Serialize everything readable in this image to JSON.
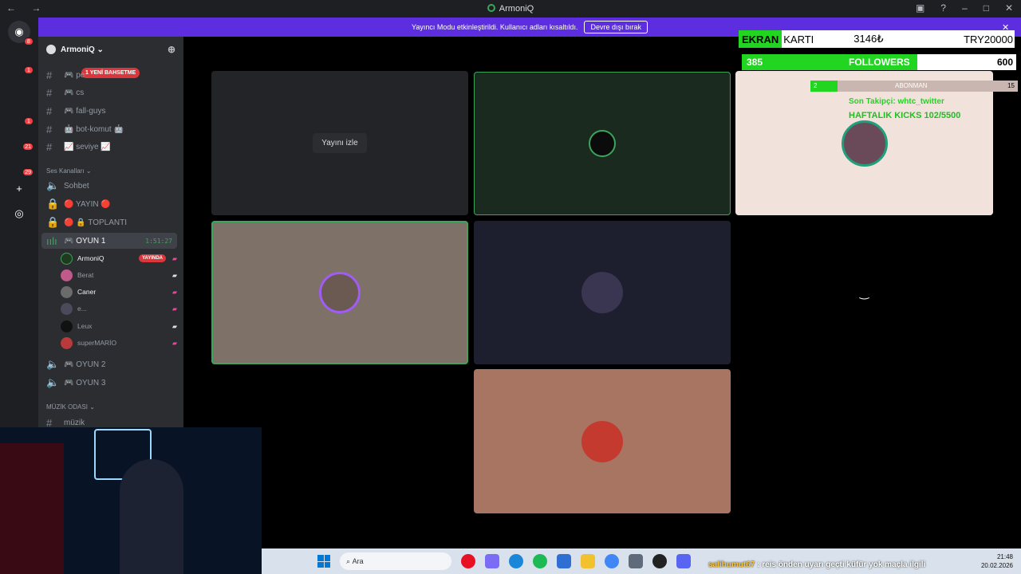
{
  "window": {
    "title": "ArmoniQ"
  },
  "banner": {
    "message": "Yayıncı Modu etkinleştirildi. Kullanıcı adları kısaltıldı.",
    "button": "Devre dışı bırak"
  },
  "servers": [
    {
      "badge": "8",
      "color": "#5865f2"
    },
    {
      "badge": "1",
      "color": "#3a5a3a"
    },
    {
      "badge": "",
      "color": "#eb459e"
    },
    {
      "badge": "1",
      "color": "#6b5a44"
    },
    {
      "badge": "21",
      "color": "#444"
    },
    {
      "badge": "29",
      "color": "#8a4a1c"
    }
  ],
  "guild": {
    "name": "ArmoniQ",
    "mention_badge": "1 YENİ BAHSETME"
  },
  "text_channels": [
    {
      "name": "🎮 pe"
    },
    {
      "name": "🎮 cs"
    },
    {
      "name": "🎮 fall-guys"
    },
    {
      "name": "🤖 bot-komut 🤖"
    },
    {
      "name": "📈 seviye 📈"
    }
  ],
  "voice_category": "Ses Kanalları",
  "voice_channels": [
    {
      "name": "Sohbet"
    },
    {
      "name": "🔴 YAYIN 🔴"
    },
    {
      "name": "🔴 🔒 TOPLANTI"
    },
    {
      "name": "🎮 OYUN 1",
      "time": "1:51:27"
    }
  ],
  "voice_users": [
    {
      "name": "ArmoniQ",
      "badge": "YAYINDA",
      "avatar_color": "#1f3a1f"
    },
    {
      "name": "Berat",
      "badge": "",
      "avatar_color": "#c05a8a"
    },
    {
      "name": "Caner",
      "badge": "",
      "avatar_color": "#6b6b6b"
    },
    {
      "name": "e...",
      "badge": "",
      "avatar_color": "#4a4a5a"
    },
    {
      "name": "Leux",
      "badge": "",
      "avatar_color": "#111"
    },
    {
      "name": "superMARİO",
      "badge": "",
      "avatar_color": "#b83a3a"
    }
  ],
  "other_voice": [
    {
      "name": "🎮 OYUN 2"
    },
    {
      "name": "🎮 OYUN 3"
    }
  ],
  "music_category": "MÜZİK ODASI",
  "music_channel": {
    "name": "müzik"
  },
  "stage": {
    "watch_label": "Yayını izle"
  },
  "overlay": {
    "ekran_label_1": "EKRAN",
    "ekran_label_2": "KARTI",
    "price_1": "3146₺",
    "price_2": "TRY20000",
    "followers_current": "385",
    "followers_label": "FOLLOWERS",
    "followers_goal": "600",
    "followers_progress": 0.64,
    "abonman_current": "2",
    "abonman_label": "ABONMAN",
    "abonman_goal": "15",
    "abonman_progress": 0.13,
    "last_follower": "Son Takipçi: whtc_twitter",
    "kicks": "HAFTALIK KICKS 102/5500"
  },
  "taskbar": {
    "search_placeholder": "Ara",
    "ticker_name": "salihumut67",
    "ticker_text": ": reis önden uyarı geçti küfür yok maçla ilgili",
    "time": "21:48",
    "date": "20.02.2026"
  }
}
